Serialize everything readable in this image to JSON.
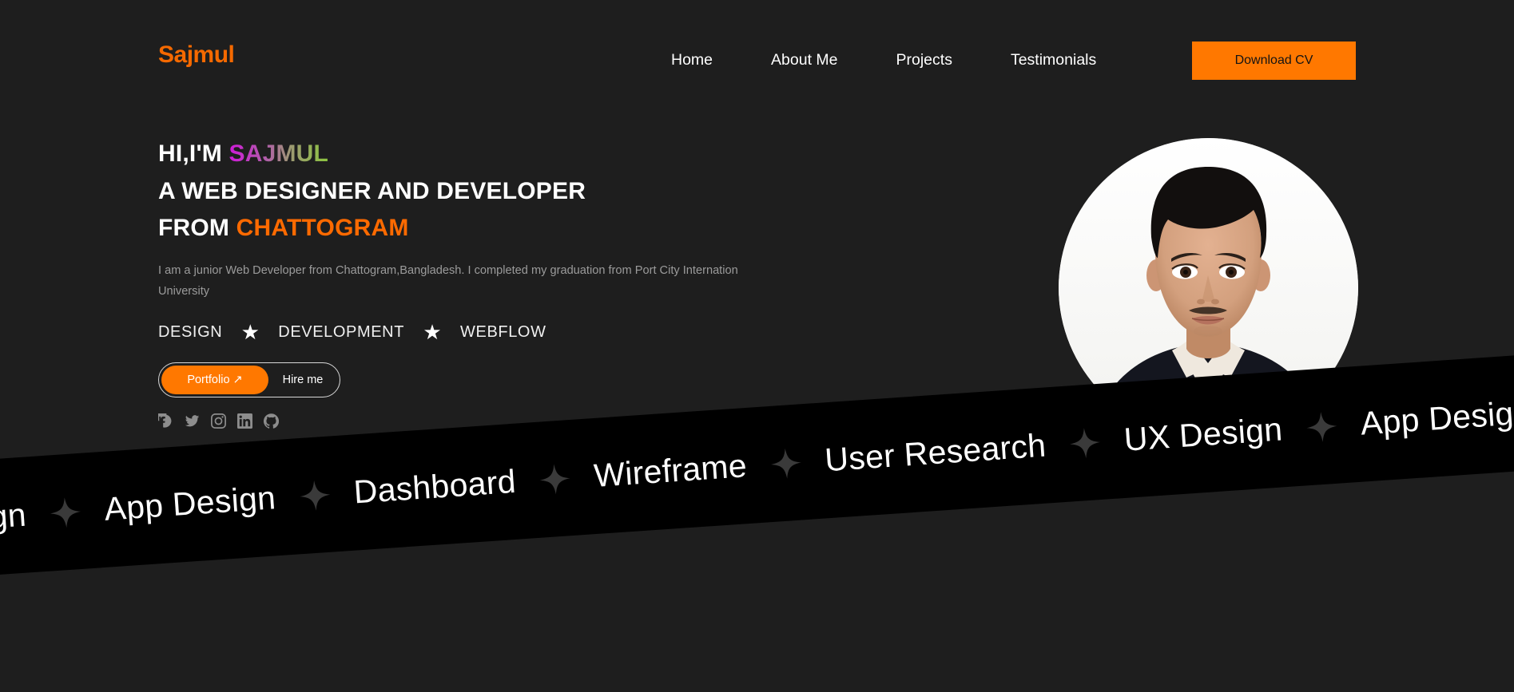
{
  "header": {
    "logo": "Sajmul",
    "nav": [
      {
        "label": "Home"
      },
      {
        "label": "About Me"
      },
      {
        "label": "Projects"
      },
      {
        "label": "Testimonials"
      }
    ],
    "cv_button": "Download CV"
  },
  "hero": {
    "greeting_prefix": "HI,I'M ",
    "name": "SAJMUL",
    "headline_line2": "A WEB DESIGNER AND DEVELOPER",
    "headline_line3_prefix": "FROM ",
    "headline_city": "CHATTOGRAM",
    "description": "I am a junior Web Developer from Chattogram,Bangladesh. I completed my graduation from Port City Internation University",
    "skills": [
      {
        "label": "DESIGN"
      },
      {
        "label": "DEVELOPMENT"
      },
      {
        "label": "WEBFLOW"
      }
    ],
    "skill_separator_icon": "star-icon",
    "portfolio_button": "Portfolio ↗",
    "hire_button": "Hire me",
    "socials": [
      {
        "name": "facebook-icon"
      },
      {
        "name": "twitter-icon"
      },
      {
        "name": "instagram-icon"
      },
      {
        "name": "linkedin-icon"
      },
      {
        "name": "github-icon"
      }
    ],
    "portrait_alt": "profile-photo"
  },
  "marquee": {
    "items": [
      "UX Design",
      "App Design",
      "Dashboard",
      "Wireframe",
      "User Research",
      "UX Design",
      "App Design"
    ],
    "separator_icon": "four-point-star-icon"
  },
  "colors": {
    "page_background": "#1e1e1e",
    "banner_background": "#000000",
    "accent_orange": "#ff7800",
    "logo_orange": "#f56900",
    "name_gradient_start": "#cf1ad9",
    "name_gradient_end": "#8cc63f",
    "text_primary": "#ffffff",
    "text_muted": "#9b9b9b",
    "social_icon": "#8d8d8d"
  }
}
